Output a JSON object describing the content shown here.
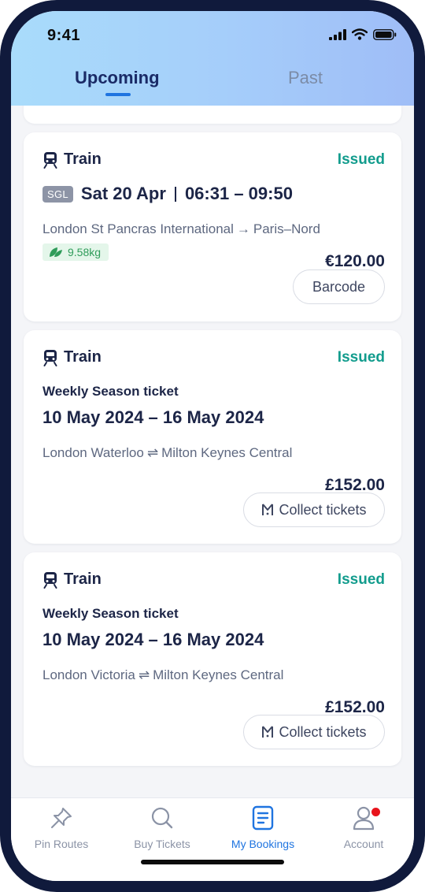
{
  "status_bar": {
    "time": "9:41"
  },
  "tabs": {
    "upcoming": "Upcoming",
    "past": "Past"
  },
  "bookings": [
    {
      "mode": "Train",
      "status": "Issued",
      "fare_type": "SGL",
      "date": "Sat 20 Apr",
      "times": "06:31 – 09:50",
      "origin": "London St Pancras International",
      "route_arrow": "→",
      "destination": "Paris–Nord",
      "co2": "9.58kg",
      "price": "€120.00",
      "action": "Barcode"
    },
    {
      "mode": "Train",
      "status": "Issued",
      "ticket_type": "Weekly Season ticket",
      "dates": "10 May 2024 – 16 May 2024",
      "origin": "London Waterloo",
      "route_arrow": "⇌",
      "destination": "Milton Keynes Central",
      "price": "£152.00",
      "action": "Collect tickets"
    },
    {
      "mode": "Train",
      "status": "Issued",
      "ticket_type": "Weekly Season ticket",
      "dates": "10 May 2024 – 16 May 2024",
      "origin": "London Victoria",
      "route_arrow": "⇌",
      "destination": "Milton Keynes Central",
      "price": "£152.00",
      "action": "Collect tickets"
    }
  ],
  "nav": [
    {
      "label": "Pin Routes",
      "icon": "pin-icon"
    },
    {
      "label": "Buy Tickets",
      "icon": "search-icon"
    },
    {
      "label": "My Bookings",
      "icon": "document-icon",
      "active": true
    },
    {
      "label": "Account",
      "icon": "person-icon",
      "has_notification": true
    }
  ],
  "colors": {
    "accent": "#1f74e0",
    "issued": "#129c8d",
    "text_primary": "#1c2547",
    "notification": "#e8141c"
  }
}
